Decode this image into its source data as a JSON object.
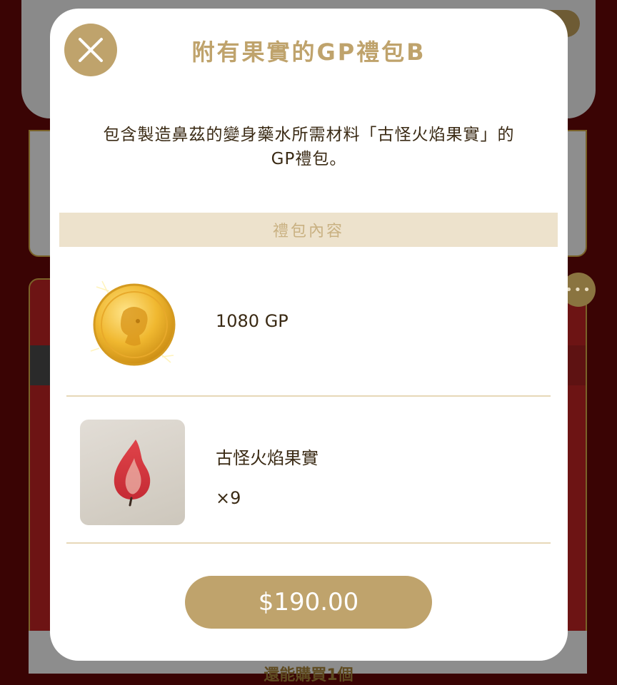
{
  "background": {
    "bottom_text": "還能購買1個"
  },
  "modal": {
    "title": "附有果實的GP禮包B",
    "description_line1": "包含製造鼻茲的變身藥水所需材料「古怪火焰果實」的",
    "description_line2": "GP禮包。",
    "section_header": "禮包內容",
    "items": [
      {
        "name": "1080 GP",
        "icon": "gold-coin-icon"
      },
      {
        "name": "古怪火焰果實",
        "quantity": "×9",
        "icon": "flame-fruit-icon"
      }
    ],
    "price": "$190.00",
    "close_icon": "close-icon"
  },
  "colors": {
    "accent_gold": "#bfa36c",
    "section_bg": "#ede2cc",
    "text_dark": "#3a2a14"
  }
}
